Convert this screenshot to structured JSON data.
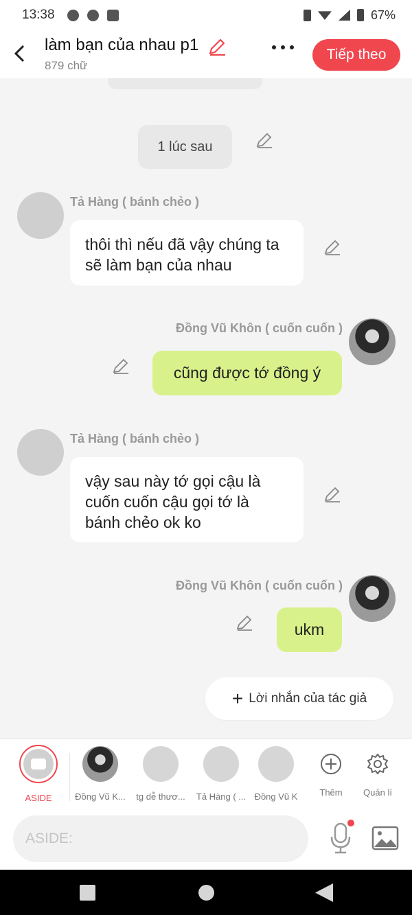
{
  "status_bar": {
    "time": "13:38",
    "battery": "67%"
  },
  "header": {
    "title": "làm bạn của nhau p1",
    "word_count": "879 chữ",
    "next_label": "Tiếp theo"
  },
  "chat": {
    "narration": "1 lúc sau",
    "messages": [
      {
        "speaker": "Tả Hàng ( bánh chẻo )",
        "text": "thôi thì nếu đã vậy chúng ta sẽ làm bạn của nhau"
      },
      {
        "speaker": "Đồng Vũ Khôn ( cuốn cuốn )",
        "text": "cũng được tớ đồng ý"
      },
      {
        "speaker": "Tả Hàng ( bánh chẻo )",
        "text": "vậy sau này tớ gọi cậu là cuốn cuốn cậu gọi tớ là bánh chẻo ok ko"
      },
      {
        "speaker": "Đồng Vũ Khôn ( cuốn cuốn )",
        "text": "ukm"
      }
    ],
    "author_note": "Lời nhắn của tác giả"
  },
  "character_bar": {
    "aside": "ASIDE",
    "characters": [
      "Đồng Vũ K...",
      "tg dễ thươ...",
      "Tả Hàng ( ...",
      "Đồng Vũ K"
    ],
    "more": "Thêm",
    "manage": "Quản lí"
  },
  "input_bar": {
    "placeholder": "ASIDE:"
  },
  "colors": {
    "accent": "#f0474f",
    "bubble_green": "#d9f18a",
    "bubble_white": "#ffffff",
    "background": "#f4f4f4"
  }
}
